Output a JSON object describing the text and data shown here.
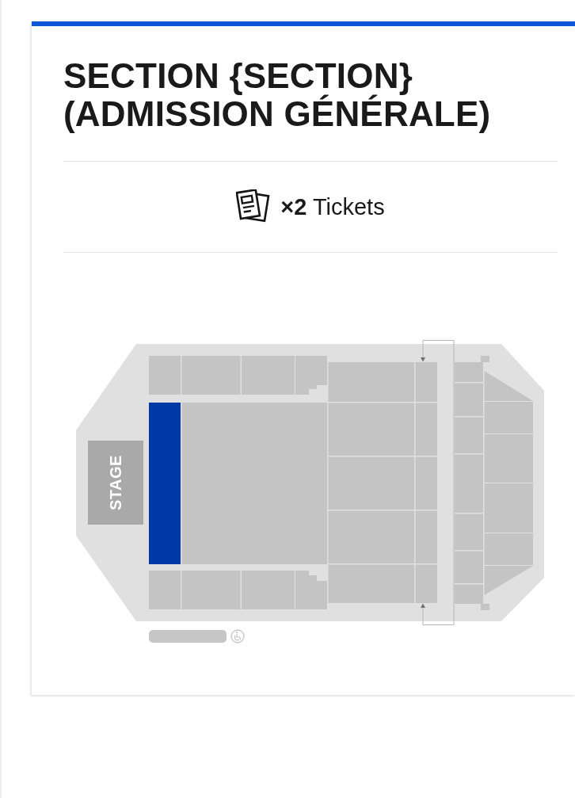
{
  "header": {
    "title": "SECTION {SECTION} (ADMISSION GÉNÉRALE)"
  },
  "tickets": {
    "text": "**×2** Tickets"
  },
  "seat_map": {
    "stage": "STAGE",
    "sections": [
      {
        "selected": false
      },
      {
        "selected": false
      },
      {
        "selected": false
      },
      {
        "selected": false
      },
      {
        "selected": true
      },
      {
        "selected": false
      },
      {
        "selected": false
      },
      {
        "selected": false
      },
      {
        "selected": false
      },
      {
        "selected": false
      },
      {
        "selected": false
      },
      {
        "selected": false
      },
      {
        "selected": false
      },
      {
        "selected": false
      },
      {
        "selected": false
      },
      {
        "selected": false
      },
      {
        "selected": false
      },
      {
        "selected": false
      },
      {
        "selected": false
      },
      {
        "selected": false
      },
      {
        "selected": false
      },
      {
        "selected": false
      },
      {
        "selected": false
      },
      {
        "selected": false
      },
      {
        "selected": false
      },
      {
        "selected": false
      },
      {
        "selected": false
      },
      {
        "selected": false
      },
      {
        "selected": false
      },
      {
        "selected": false
      },
      {
        "selected": false
      },
      {
        "selected": false
      },
      {
        "selected": false
      }
    ]
  }
}
